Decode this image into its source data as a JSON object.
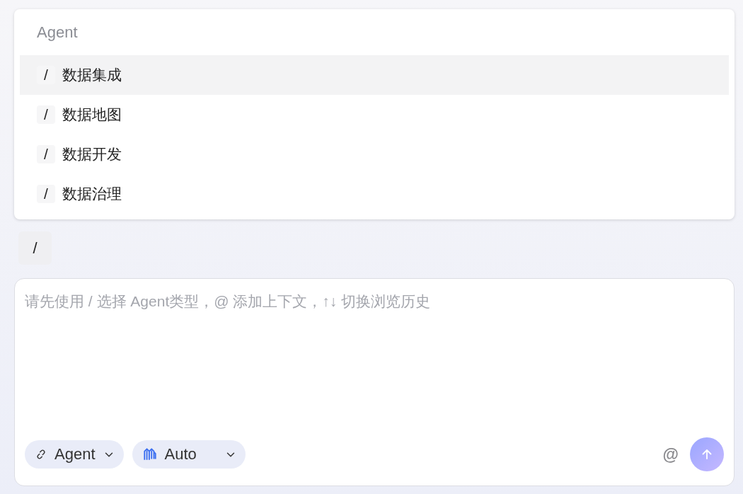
{
  "menu": {
    "header": "Agent",
    "items": [
      {
        "prefix": "/",
        "label": "数据集成",
        "selected": true
      },
      {
        "prefix": "/",
        "label": "数据地图",
        "selected": false
      },
      {
        "prefix": "/",
        "label": "数据开发",
        "selected": false
      },
      {
        "prefix": "/",
        "label": "数据治理",
        "selected": false
      }
    ]
  },
  "command_chip": "/",
  "composer": {
    "placeholder": "请先使用 / 选择 Agent类型，@ 添加上下文，↑↓ 切换浏览历史",
    "agent_select": {
      "label": "Agent"
    },
    "model_select": {
      "label": "Auto"
    },
    "mention_button": "@"
  }
}
